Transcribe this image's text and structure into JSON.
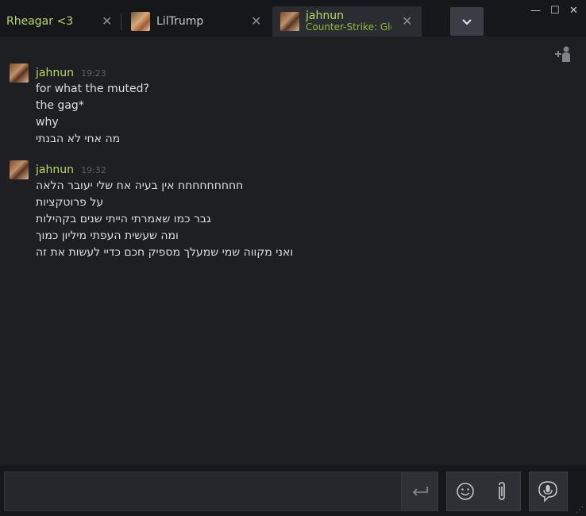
{
  "tabs": [
    {
      "name": "Rheagar <3",
      "close": "✕"
    },
    {
      "name": "LilTrump",
      "close": "✕"
    },
    {
      "name": "jahnun",
      "game": "Counter-Strike: Global Offensive",
      "close": "✕"
    }
  ],
  "window": {
    "minimize": "—",
    "maximize": "☐",
    "close": "✕",
    "dropdown": "⌄"
  },
  "chat": {
    "add_friend_icon": "add-friend-icon",
    "groups": [
      {
        "author": "jahnun",
        "time": "19:23",
        "lines": [
          "for what the muted?",
          "the gag*",
          "why",
          "מה אחי לא הבנתי"
        ]
      },
      {
        "author": "jahnun",
        "time": "19:32",
        "lines": [
          "חחחחחחחחח אין בעיה אח שלי יעובר הלאה",
          "על פרוטקציות",
          "גבר כמו שאמרתי הייתי שנים בקהילות",
          "ומה שעשית העפתי מיליון כמוך",
          "ואני מקווה שמי שמעלך מספיק חכם כדיי לעשות את זה"
        ]
      }
    ]
  },
  "composer": {
    "input_value": "",
    "send_icon": "↵"
  },
  "colors": {
    "accent_green": "#b8d96a",
    "background": "#1e1f23",
    "tabbar": "#15171b"
  }
}
